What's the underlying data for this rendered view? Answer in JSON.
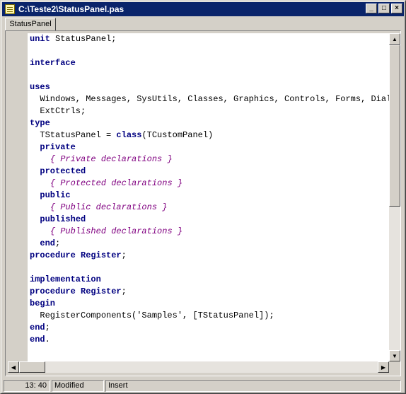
{
  "window": {
    "title": "C:\\Teste2\\StatusPanel.pas"
  },
  "tabs": [
    {
      "label": "StatusPanel"
    }
  ],
  "title_buttons": {
    "minimize": "_",
    "maximize": "□",
    "close": "×"
  },
  "code_lines": [
    [
      {
        "t": "unit",
        "s": "kw"
      },
      {
        "t": " StatusPanel;"
      }
    ],
    [],
    [
      {
        "t": "interface",
        "s": "kw"
      }
    ],
    [],
    [
      {
        "t": "uses",
        "s": "kw"
      }
    ],
    [
      {
        "t": "  Windows, Messages, SysUtils, Classes, Graphics, Controls, Forms, Dialogs,"
      }
    ],
    [
      {
        "t": "  ExtCtrls;"
      }
    ],
    [
      {
        "t": "type",
        "s": "kw"
      }
    ],
    [
      {
        "t": "  TStatusPanel = "
      },
      {
        "t": "class",
        "s": "kw"
      },
      {
        "t": "(TCustomPanel)"
      }
    ],
    [
      {
        "t": "  "
      },
      {
        "t": "private",
        "s": "kw"
      }
    ],
    [
      {
        "t": "    "
      },
      {
        "t": "{ Private declarations }",
        "s": "cm"
      }
    ],
    [
      {
        "t": "  "
      },
      {
        "t": "protected",
        "s": "kw"
      }
    ],
    [
      {
        "t": "    "
      },
      {
        "t": "{ Protected declarations }",
        "s": "cm"
      }
    ],
    [
      {
        "t": "  "
      },
      {
        "t": "public",
        "s": "kw"
      }
    ],
    [
      {
        "t": "    "
      },
      {
        "t": "{ Public declarations }",
        "s": "cm"
      }
    ],
    [
      {
        "t": "  "
      },
      {
        "t": "published",
        "s": "kw"
      }
    ],
    [
      {
        "t": "    "
      },
      {
        "t": "{ Published declarations }",
        "s": "cm"
      }
    ],
    [
      {
        "t": "  "
      },
      {
        "t": "end",
        "s": "kw"
      },
      {
        "t": ";"
      }
    ],
    [
      {
        "t": "procedure",
        "s": "kw"
      },
      {
        "t": " "
      },
      {
        "t": "Register",
        "s": "kw"
      },
      {
        "t": ";"
      }
    ],
    [],
    [
      {
        "t": "implementation",
        "s": "kw"
      }
    ],
    [
      {
        "t": "procedure",
        "s": "kw"
      },
      {
        "t": " "
      },
      {
        "t": "Register",
        "s": "kw"
      },
      {
        "t": ";"
      }
    ],
    [
      {
        "t": "begin",
        "s": "kw"
      }
    ],
    [
      {
        "t": "  RegisterComponents('Samples', [TStatusPanel]);"
      }
    ],
    [
      {
        "t": "end",
        "s": "kw"
      },
      {
        "t": ";"
      }
    ],
    [
      {
        "t": "end",
        "s": "kw"
      },
      {
        "t": "."
      }
    ]
  ],
  "status": {
    "position": "13: 40",
    "modified": "Modified",
    "mode": "Insert"
  },
  "colors": {
    "titlebar": "#0a246a",
    "keyword": "#000080",
    "comment": "#800080",
    "face": "#d4d0c8"
  }
}
